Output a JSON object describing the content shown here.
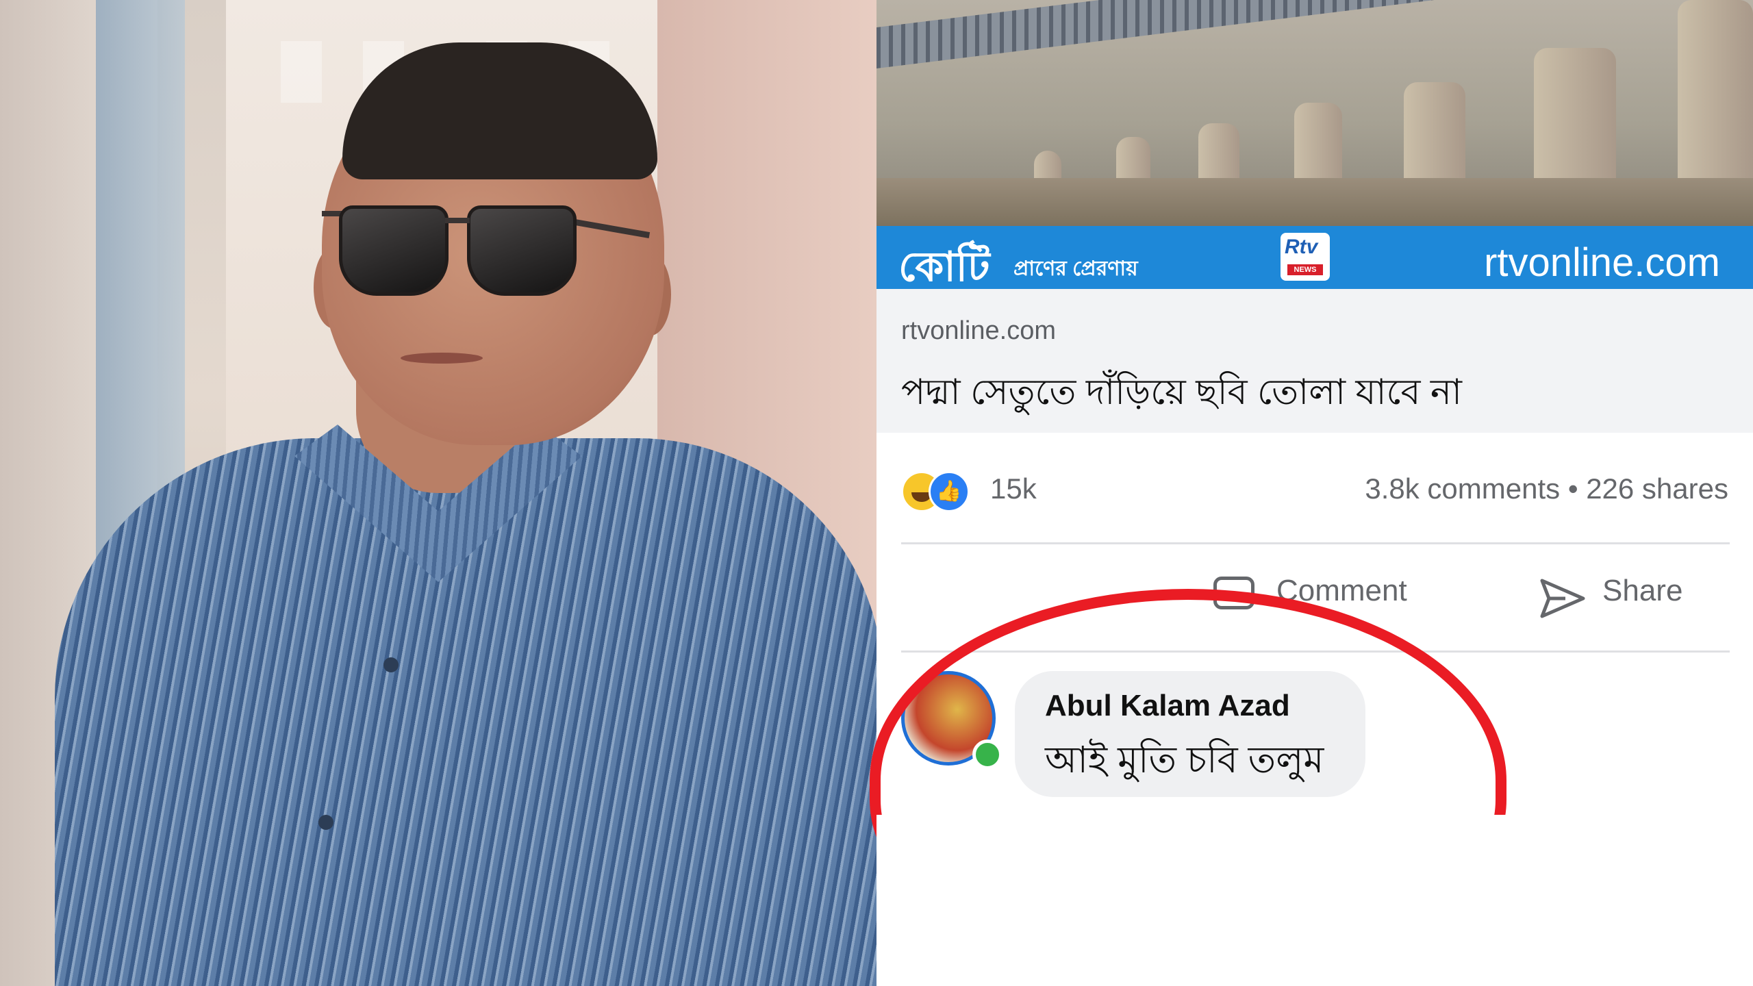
{
  "left_photo": {
    "description_icon": "person-photo"
  },
  "news_banner": {
    "koti": "কোটি",
    "koti_sub": "প্রাণের প্রেরণায়",
    "logo_text": "Rtv",
    "logo_news": "NEWS",
    "site": "rtvonline.com"
  },
  "link_card": {
    "domain": "rtvonline.com",
    "headline": "পদ্মা সেতুতে দাঁড়িয়ে ছবি তোলা যাবে না"
  },
  "reactions": {
    "count": "15k",
    "stats": "3.8k comments • 226 shares"
  },
  "actions": {
    "comment": "Comment",
    "share": "Share"
  },
  "comment": {
    "author": "Abul Kalam Azad",
    "text": "আই মুতি চবি তলুম"
  },
  "colors": {
    "facebook_blue": "#1e88d8",
    "highlight_red": "#ea1c24",
    "online_green": "#37b34a"
  }
}
